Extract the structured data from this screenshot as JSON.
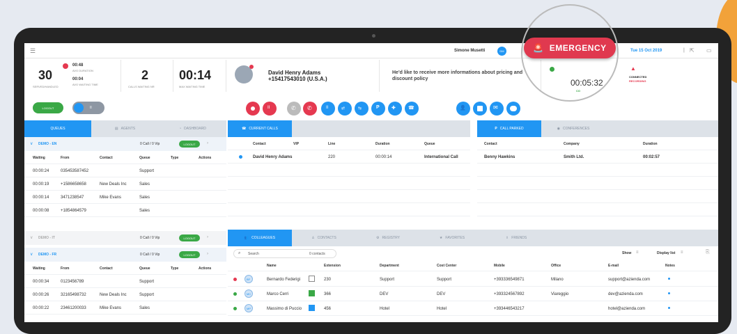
{
  "header": {
    "user": "Simone Musetti",
    "user_badge": "DM",
    "date": "Tue 15 Oct 2019"
  },
  "emergency": {
    "label": "EMERGENCY"
  },
  "kpis": {
    "served_value": "30",
    "served_label": "SERVED/HANDLED",
    "avg_duration": "00:48",
    "avg_duration_label": "AVG DURATION",
    "avg_wait": "00:04",
    "avg_wait_label": "AVG WAITING TIME",
    "calls_waiting": "2",
    "calls_waiting_label": "CALLS WAITING NR",
    "max_wait": "00:14",
    "max_wait_label": "MAX WAITING TIME"
  },
  "caller": {
    "name": "David Henry Adams",
    "number": "+15417543010 (U.S.A.)",
    "note": "He'd like to receive more informations about pricing and discount policy"
  },
  "call_status": {
    "timer": "00:05:32",
    "connected": "CONNECTED",
    "recording": "RECORDING",
    "indicator": "CO"
  },
  "left_panel": {
    "logout": "LOGOUT",
    "tabs": [
      "QUEUES",
      "AGENTS",
      "DASHBOARD"
    ],
    "queues": [
      {
        "name": "DEMO - EN",
        "stats": "0 Call / 0 Vip",
        "btn": "LOGOUT",
        "active": true
      },
      {
        "name": "DEMO - IT",
        "stats": "0 Call / 0 Vip",
        "btn": "LOGOUT",
        "active": false
      },
      {
        "name": "DEMO - FR",
        "stats": "0 Call / 0 Vip",
        "btn": "LOGOUT",
        "active": true
      }
    ],
    "columns": [
      "Waiting",
      "From",
      "Contact",
      "Queue",
      "Type",
      "Actions"
    ],
    "rows_en": [
      [
        "00:00:24",
        "035453587452",
        "",
        "Support"
      ],
      [
        "00:00:19",
        "+1586658658",
        "New Deals Inc",
        "Sales"
      ],
      [
        "00:00:14",
        "3471238547",
        "Mike Evans",
        "Sales"
      ],
      [
        "00:00:08",
        "+1854864579",
        "",
        "Sales"
      ]
    ],
    "rows_fr": [
      [
        "00:00:34",
        "0123456789",
        "",
        "Support"
      ],
      [
        "00:00:26",
        "32165498732",
        "New Deals Inc",
        "Support"
      ],
      [
        "00:00:22",
        "23461200033",
        "Mike Evans",
        "Sales"
      ]
    ]
  },
  "current_calls": {
    "tab": "CURRENT CALLS",
    "columns": [
      "Contact",
      "VIP",
      "Line",
      "Duration",
      "Queue"
    ],
    "rows": [
      [
        "David Henry Adams",
        "",
        "220",
        "00:00:14",
        "International Call"
      ]
    ]
  },
  "parked": {
    "tabs": [
      "CALL PARKED",
      "CONFERENCES"
    ],
    "columns": [
      "Contact",
      "Company",
      "Duration"
    ],
    "rows": [
      [
        "Benny Hawkins",
        "Smith Ltd.",
        "00:02:57"
      ]
    ]
  },
  "bottom": {
    "tabs": [
      "COLLEAGUES",
      "CONTACTS",
      "REGISTRY",
      "FAVORITES",
      "FRIENDS"
    ],
    "search_placeholder": "Search",
    "contacts_count": "0 contacts",
    "show_label": "Show",
    "display_label": "Display list",
    "columns": [
      "Name",
      "Extension",
      "Department",
      "Cost Center",
      "Mobile",
      "Office",
      "E-mail",
      "Notes"
    ],
    "rows": [
      {
        "name": "Bernardo Federigi",
        "ext": "230",
        "dept": "Support",
        "cost": "Support",
        "mobile": "+393336549871",
        "office": "Milano",
        "email": "support@azienda.com",
        "initials": "BF",
        "status": "#e53950"
      },
      {
        "name": "Marco Cerri",
        "ext": "366",
        "dept": "DEV",
        "cost": "DEV",
        "mobile": "+393324567892",
        "office": "Viareggio",
        "email": "dev@azienda.com",
        "initials": "MC",
        "status": "#3aa846"
      },
      {
        "name": "Massimo di Puccio",
        "ext": "456",
        "dept": "Hotel",
        "cost": "Hotel",
        "mobile": "+393446543217",
        "office": "",
        "email": "hotel@azienda.com",
        "initials": "MP",
        "status": "#3aa846"
      }
    ]
  },
  "colors": {
    "accent": "#2196f3",
    "danger": "#e0394f",
    "success": "#3aa846"
  }
}
